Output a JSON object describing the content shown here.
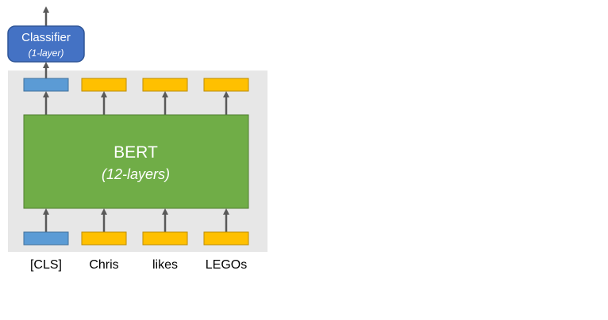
{
  "classifier": {
    "title": "Classifier",
    "subtitle": "(1-layer)"
  },
  "model": {
    "title": "BERT",
    "subtitle": "(12-layers)"
  },
  "tokens": [
    {
      "label": "[CLS]"
    },
    {
      "label": "Chris"
    },
    {
      "label": "likes"
    },
    {
      "label": "LEGOs"
    }
  ],
  "colors": {
    "background_panel": "#e7e7e7",
    "bert_fill": "#70ad47",
    "bert_border": "#507e32",
    "classifier_fill": "#4472c4",
    "classifier_border": "#2f5597",
    "cls_token": "#5b9bd5",
    "cls_token_border": "#41719c",
    "word_token": "#ffc000",
    "word_token_border": "#bc8c00",
    "arrow": "#595959",
    "text_dark": "#000000",
    "text_light": "#ffffff"
  },
  "icons": {
    "arrow": "arrow-up-icon"
  }
}
